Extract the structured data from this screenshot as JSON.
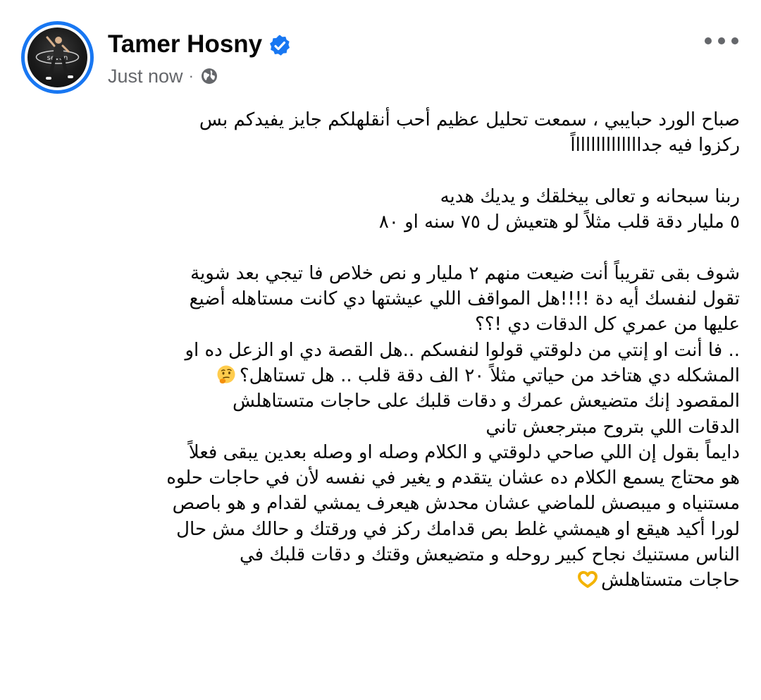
{
  "post": {
    "author": "Tamer Hosny",
    "timestamp": "Just now",
    "meta_separator": "·",
    "avatar_logo_text": "seven",
    "icons": {
      "verified": "verified-badge-icon",
      "privacy": "globe-icon",
      "more": "more-options-icon"
    },
    "colors": {
      "accent": "#1877f2",
      "text": "#050505",
      "secondary_text": "#65676b"
    },
    "lines": [
      {
        "text": "صباح الورد حبايبي ، سمعت تحليل عظيم أحب أنقلهلكم جايز يفيدكم بس"
      },
      {
        "text": "ركزوا فيه جدااااااااااااااً"
      },
      {
        "text": ""
      },
      {
        "text": "ربنا سبحانه و تعالى بيخلقك و يديك هديه"
      },
      {
        "text": "٥ مليار دقة قلب مثلاً لو هتعيش ل ٧٥ سنه او ٨٠ "
      },
      {
        "text": ""
      },
      {
        "text": " شوف بقى تقريباً أنت ضيعت منهم ٢ مليار و نص خلاص  فا تيجي بعد شوية"
      },
      {
        "text": "تقول لنفسك أيه دة !!!!هل المواقف اللي عيشتها دي كانت مستاهله أضيع"
      },
      {
        "text": "عليها من عمري كل الدقات دي !؟؟"
      },
      {
        "text": ".. فا أنت او إنتي من دلوقتي قولوا لنفسكم ..هل  القصة دي او الزعل ده او"
      },
      {
        "text": "المشكله دي هتاخد من حياتي مثلاً ٢٠ الف دقة قلب .. هل تستاهل؟",
        "emoji_after": "thinking-face-emoji"
      },
      {
        "text": "المقصود إنك متضيعش عمرك و دقات قلبك على حاجات متستاهلش"
      },
      {
        "text": "الدقات اللي بتروح مبترجعش تاني"
      },
      {
        "text": "دايماً بقول إن اللي صاحي دلوقتي و الكلام وصله او وصله بعدين يبقى فعلاً"
      },
      {
        "text": "هو محتاج يسمع الكلام ده عشان يتقدم و يغير في نفسه لأن في حاجات حلوه"
      },
      {
        "text": "مستنياه و ميبصش للماضي عشان محدش هيعرف يمشي لقدام و هو باصص"
      },
      {
        "text": "لورا أكيد هيقع او هيمشي غلط  بص قدامك ركز في ورقتك و حالك مش حال"
      },
      {
        "text": "الناس مستنيك نجاح كبير روحله و متضيعش وقتك و دقات قلبك  في"
      },
      {
        "text": "حاجات متستاهلش",
        "emoji_after": "heart-hands-emoji"
      }
    ]
  }
}
